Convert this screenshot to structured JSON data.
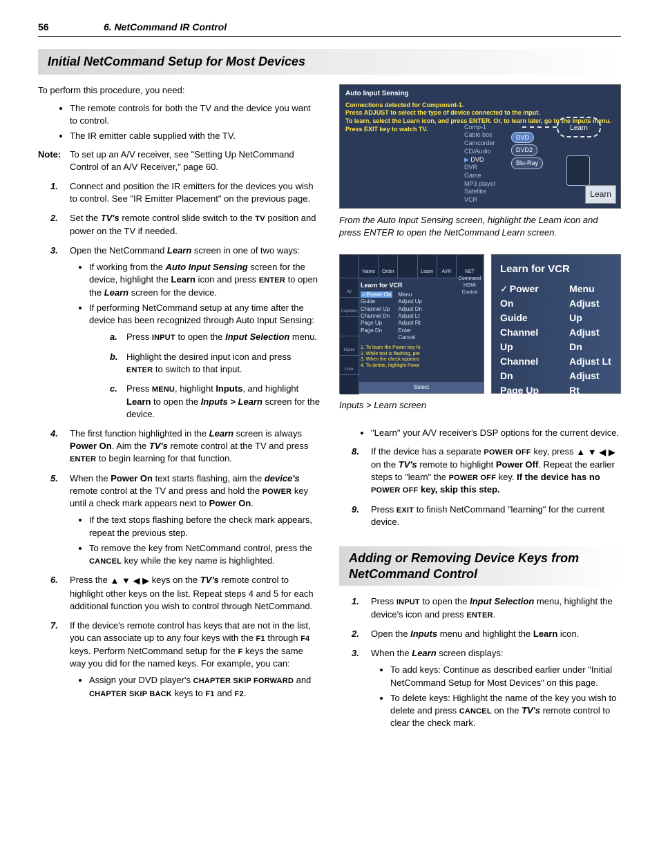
{
  "header": {
    "page": "56",
    "chapter": "6.  NetCommand IR Control"
  },
  "section1_title": "Initial NetCommand Setup for Most Devices",
  "intro": "To perform this procedure, you need:",
  "intro_bullets": [
    "The remote controls for both the TV and the device you want to control.",
    "The IR emitter cable supplied with the TV."
  ],
  "note_label": "Note:",
  "note_text": "To set up an A/V receiver, see \"Setting Up NetCommand Control of an A/V Receiver,\" page 60.",
  "steps_left": {
    "s1": "Connect and position the IR emitters for the devices you wish to control.  See \"IR Emitter Placement\" on the previous page.",
    "s2_a": "Set the ",
    "s2_b": " remote control slide switch to the ",
    "s2_c": " position and power on the TV if needed.",
    "s3_a": "Open the NetCommand ",
    "s3_b": " screen in one of two ways:",
    "s3_bullet1_a": "If working from the ",
    "s3_bullet1_b": " screen for the device, highlight the ",
    "s3_bullet1_c": " icon and press ",
    "s3_bullet1_d": " to open the ",
    "s3_bullet1_e": " screen for the device.",
    "s3_bullet2": "If performing NetCommand setup at any time after the device has been recognized through Auto Input Sensing:",
    "s3a_a": "Press ",
    "s3a_b": " to open the ",
    "s3a_c": " menu.",
    "s3b_a": "Highlight the desired input icon and press ",
    "s3b_b": " to switch to that input.",
    "s3c_a": "Press ",
    "s3c_b": ", highlight ",
    "s3c_c": ", and highlight ",
    "s3c_d": " to open the ",
    "s3c_e": " screen for the device.",
    "s4_a": "The first function highlighted in the ",
    "s4_b": " screen is always ",
    "s4_c": ".  Aim the ",
    "s4_d": " remote control at the TV and press ",
    "s4_e": " to begin learning for that function.",
    "s5_a": "When the ",
    "s5_b": " text starts flashing, aim the ",
    "s5_c": " remote control at the TV and press and hold the ",
    "s5_d": " key until a check mark appears next to ",
    "s5_e": ".",
    "s5_bullet1": "If the text stops flashing before the check mark appears, repeat the previous step.",
    "s5_bullet2_a": "To remove the key from NetCommand control, press the ",
    "s5_bullet2_b": " key while the key name is highlighted.",
    "s6_a": "Press the ",
    "s6_b": " keys on the ",
    "s6_c": " remote control to highlight other keys on the list.  Repeat steps 4 and 5 for each additional function you wish to control through NetCommand.",
    "s7_a": "If the device's remote control has keys that are not in the list, you can associate up to any four keys with the ",
    "s7_b": " through ",
    "s7_c": " keys.  Perform NetCommand setup for the ",
    "s7_d": " keys the same way you did for the named keys.  For example, you can:",
    "s7_bullet1_a": "Assign your DVD player's ",
    "s7_bullet1_b": " and ",
    "s7_bullet1_c": " keys to ",
    "s7_bullet1_d": " and ",
    "s7_bullet1_e": "."
  },
  "labels": {
    "tvs": "TV's",
    "tv": "TV",
    "learn": "Learn",
    "ais": "Auto Input Sensing",
    "learn_b": "Learn",
    "enter": "ENTER",
    "input": "INPUT",
    "inputsel": "Input Selection",
    "menu": "MENU",
    "inputs": "Inputs",
    "learn_path": "Inputs > Learn",
    "poweron": "Power On",
    "devices": "device's",
    "power": "POWER",
    "cancel": "CANCEL",
    "f1": "F1",
    "f4": "F4",
    "f": "F",
    "csf": "CHAPTER SKIP FORWARD",
    "csb": "CHAPTER SKIP BACK",
    "f2": "F2",
    "poweroff": "POWER OFF",
    "poweroff_b": "Power Off",
    "exit": "EXIT"
  },
  "arrows": "▲ ▼ ◀ ▶",
  "fig1": {
    "header": "Auto Input Sensing",
    "l1": "Connections detected for Component-1.",
    "l2": "Press ADJUST to select the type of device connected to the input.",
    "l3": "To learn, select the Learn icon, and press ENTER.  Or, to learn later, go to the Inputs menu.",
    "l4": "Press EXIT key to watch TV.",
    "device_list": [
      "Comp-1",
      "Cable box",
      "Camcorder",
      "CD/Audio",
      "DVD",
      "DVR",
      "Game",
      "MP3 player",
      "Satellite",
      "VCR"
    ],
    "ovals": [
      "DVD",
      "DVD2",
      "Blu-Ray"
    ],
    "learn_label": "Learn",
    "callout": "Learn"
  },
  "caption1": "From the Auto Input Sensing screen, highlight the Learn icon and press ENTER to open the NetCommand Learn screen.",
  "fig2": {
    "top_tabs": [
      "",
      "Name",
      "Order",
      "",
      "Learn",
      "AVR",
      "NET Command HDMI Control"
    ],
    "left_tabs": [
      "AV",
      "Captions",
      "",
      "Inputs",
      "Lock"
    ],
    "panel_title": "Learn for VCR",
    "colA": [
      "Power On",
      "Guide",
      "Channel Up",
      "Channel Dn",
      "Page Up",
      "Page Dn"
    ],
    "colB": [
      "Menu",
      "Adjust Up",
      "Adjust Dn",
      "Adjust Lt",
      "Adjust Rt",
      "Enter",
      "Cancel"
    ],
    "instr": [
      "1. To learn the Power key fo",
      "2. While text is flashing, pre",
      "3. When the check appears",
      "4. To delete, highlight Powe"
    ],
    "bottom": "Select"
  },
  "fig2zoom": {
    "title": "Learn for VCR",
    "colA": [
      "Power On",
      "Guide",
      "Channel Up",
      "Channel Dn",
      "Page Up",
      "Page Dn"
    ],
    "colB": [
      "Menu",
      "Adjust Up",
      "Adjust Dn",
      "Adjust Lt",
      "Adjust Rt",
      "Enter",
      "Cancel"
    ]
  },
  "caption2": "Inputs > Learn screen",
  "right_cont": {
    "bullet7b": "\"Learn\" your A/V receiver's DSP options for the current device.",
    "s8_a": "If the device has a separate ",
    "s8_b": " key, press ",
    "s8_c": " on the ",
    "s8_d": " remote to highlight ",
    "s8_e": ".  Repeat the earlier steps to \"learn\" the ",
    "s8_f": " key.  ",
    "s8_g": "If the device has no ",
    "s8_h": " key, skip this step.",
    "s9_a": "Press ",
    "s9_b": " to finish NetCommand \"learning\" for the current device."
  },
  "section2_title": "Adding or Removing Device Keys from NetCommand Control",
  "sec2": {
    "s1_a": "Press ",
    "s1_b": " to open the ",
    "s1_c": " menu, highlight the device's icon and press ",
    "s1_d": ".",
    "s2_a": "Open the ",
    "s2_b": " menu and highlight the ",
    "s2_c": " icon.",
    "s3_a": "When the ",
    "s3_b": " screen displays:",
    "s3_bullet1": "To add keys:  Continue as described earlier under \"Initial NetCommand Setup for Most Devices\" on this page.",
    "s3_bullet2_a": "To delete keys:  Highlight the name of the key you wish to delete and press ",
    "s3_bullet2_b": " on the ",
    "s3_bullet2_c": " remote control to clear the check mark."
  }
}
